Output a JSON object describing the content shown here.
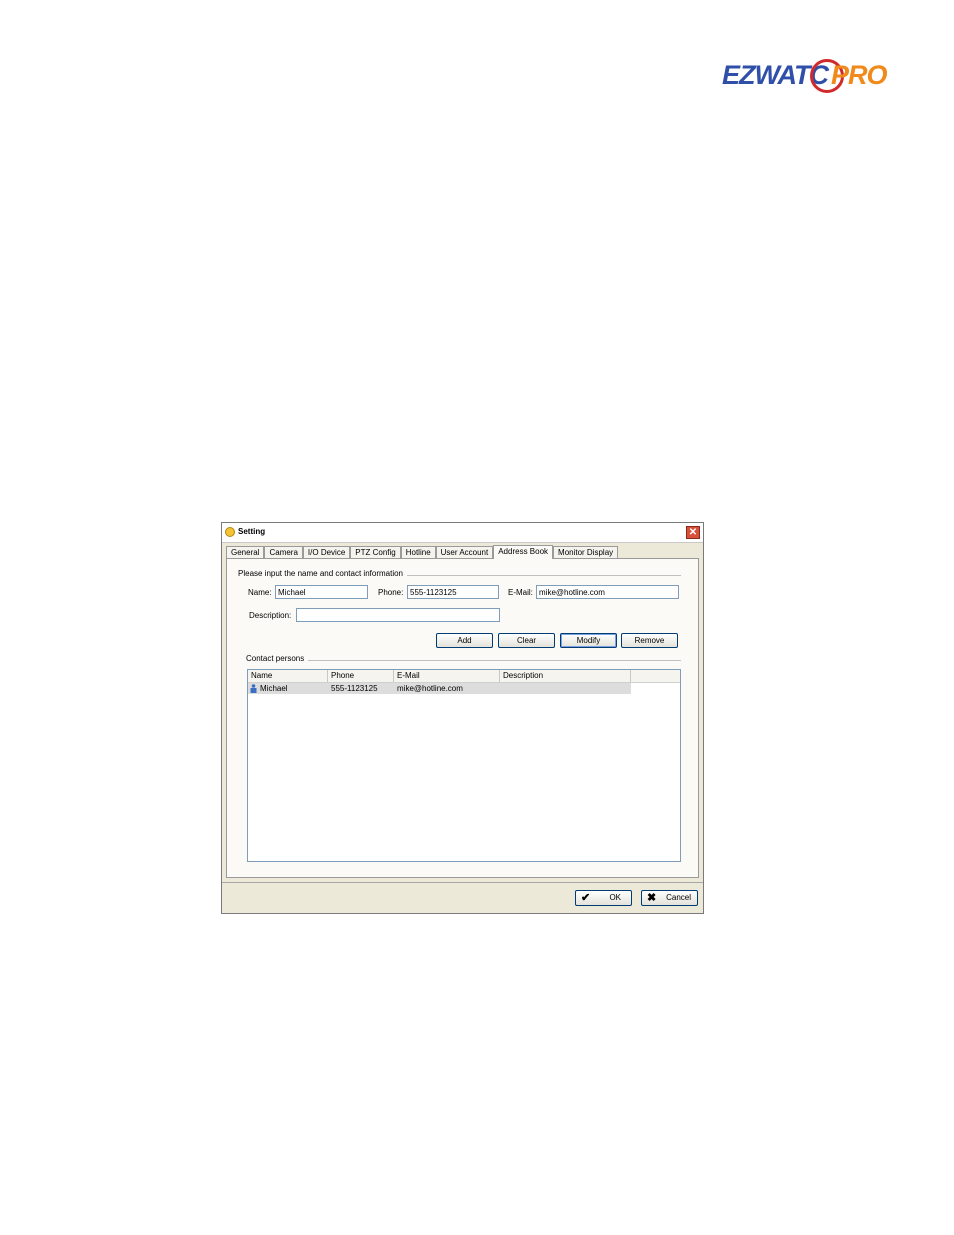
{
  "logo": {
    "part1": "EZWATC",
    "part2": "PRO"
  },
  "window": {
    "title": "Setting",
    "close_glyph": "✕",
    "tabs": [
      "General",
      "Camera",
      "I/O Device",
      "PTZ Config",
      "Hotline",
      "User Account",
      "Address Book",
      "Monitor Display"
    ],
    "active_tab": "Address Book"
  },
  "form": {
    "group_label": "Please input the name and contact information",
    "name_label": "Name:",
    "name_value": "Michael",
    "phone_label": "Phone:",
    "phone_value": "555-1123125",
    "email_label": "E-Mail:",
    "email_value": "mike@hotline.com",
    "description_label": "Description:",
    "description_value": ""
  },
  "actions": {
    "add": "Add",
    "clear": "Clear",
    "modify": "Modify",
    "remove": "Remove"
  },
  "contacts": {
    "group_label": "Contact persons",
    "columns": [
      "Name",
      "Phone",
      "E-Mail",
      "Description"
    ],
    "rows": [
      {
        "name": "Michael",
        "phone": "555-1123125",
        "email": "mike@hotline.com",
        "description": "",
        "icon": "contact-person-icon"
      }
    ]
  },
  "footer": {
    "ok": "OK",
    "cancel": "Cancel",
    "ok_icon": "✔",
    "cancel_icon": "✖"
  },
  "colors": {
    "logo_blue": "#2f4fa8",
    "logo_orange": "#f08a1a",
    "logo_red": "#d22a2a",
    "window_bg": "#ece9d8"
  }
}
